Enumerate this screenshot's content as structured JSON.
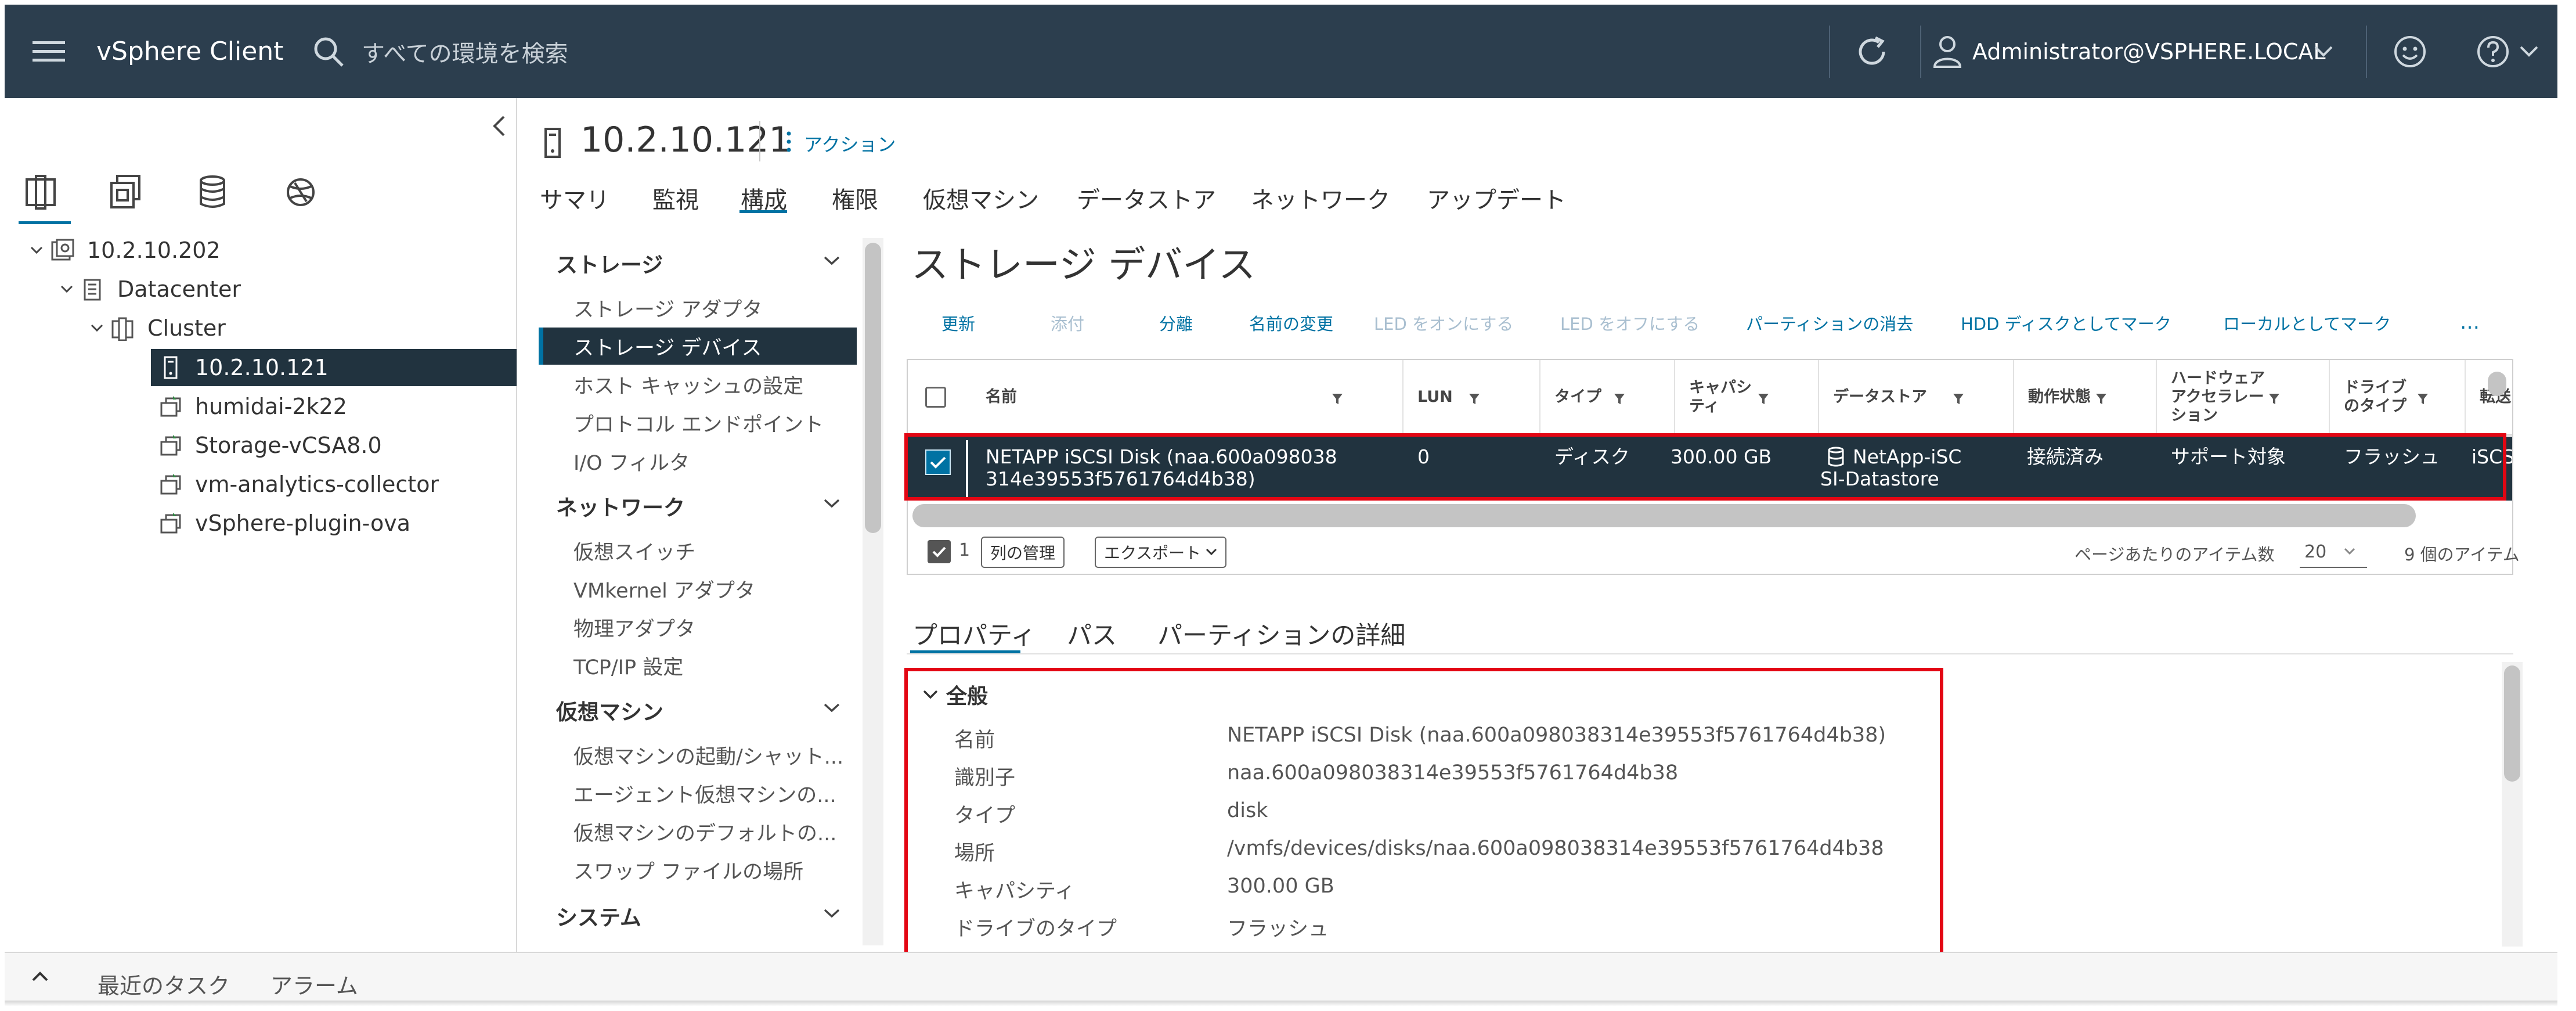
{
  "header": {
    "brand": "vSphere Client",
    "search_placeholder": "すべての環境を検索",
    "user": "Administrator@VSPHERE.LOCAL"
  },
  "icons": {
    "menu": "hamburger-icon",
    "search": "search-icon",
    "refresh": "refresh-icon",
    "user": "user-icon",
    "feedback": "smiley-icon",
    "help": "help-icon"
  },
  "colors": {
    "topbar": "#2c3e4e",
    "selection": "#21333f",
    "accent": "#0072a3",
    "highlight_box": "#e30613"
  },
  "tree": [
    {
      "label": "10.2.10.202",
      "icon": "vcenter-icon",
      "expanded": true
    },
    {
      "label": "Datacenter",
      "icon": "datacenter-icon",
      "expanded": true
    },
    {
      "label": "Cluster",
      "icon": "cluster-icon",
      "expanded": true
    },
    {
      "label": "10.2.10.121",
      "icon": "host-icon",
      "selected": true
    },
    {
      "label": "humidai-2k22",
      "icon": "vm-icon"
    },
    {
      "label": "Storage-vCSA8.0",
      "icon": "vm-icon"
    },
    {
      "label": "vm-analytics-collector",
      "icon": "vm-icon"
    },
    {
      "label": "vSphere-plugin-ova",
      "icon": "vm-icon"
    }
  ],
  "object": {
    "title": "10.2.10.121",
    "actions_label": "アクション"
  },
  "main_tabs": [
    "サマリ",
    "監視",
    "構成",
    "権限",
    "仮想マシン",
    "データストア",
    "ネットワーク",
    "アップデート"
  ],
  "config_nav": {
    "storage": {
      "title": "ストレージ",
      "items": [
        "ストレージ アダプタ",
        "ストレージ デバイス",
        "ホスト キャッシュの設定",
        "プロトコル エンドポイント",
        "I/O フィルタ"
      ]
    },
    "network": {
      "title": "ネットワーク",
      "items": [
        "仮想スイッチ",
        "VMkernel アダプタ",
        "物理アダプタ",
        "TCP/IP 設定"
      ]
    },
    "vm": {
      "title": "仮想マシン",
      "items": [
        "仮想マシンの起動/シャット...",
        "エージェント仮想マシンの...",
        "仮想マシンのデフォルトの...",
        "スワップ ファイルの場所"
      ]
    },
    "system": {
      "title": "システム"
    }
  },
  "content": {
    "title": "ストレージ デバイス",
    "toolbar": [
      "更新",
      "添付",
      "分離",
      "名前の変更",
      "LED をオンにする",
      "LED をオフにする",
      "パーティションの消去",
      "HDD ディスクとしてマーク",
      "ローカルとしてマーク"
    ],
    "toolbar_more": "…"
  },
  "grid": {
    "columns": [
      "名前",
      "LUN",
      "タイプ",
      "キャパシティ",
      "データストア",
      "動作状態",
      "ハードウェア アクセラレーション",
      "ドライブのタイプ",
      "転送"
    ],
    "column_lines": {
      "capacity": [
        "キャパシ",
        "ティ"
      ],
      "hw_accel": [
        "ハードウェア",
        "アクセラレー",
        "ション"
      ],
      "drive_type": [
        "ドライブ",
        "のタイプ"
      ]
    },
    "row": {
      "name_line1": "NETAPP iSCSI Disk (naa.600a098038",
      "name_line2": "314e39553f5761764d4b38)",
      "lun": "0",
      "type": "ディスク",
      "capacity": "300.00 GB",
      "datastore_line1": "NetApp-iSC",
      "datastore_line2": "SI-Datastore",
      "status": "接続済み",
      "hw_accel": "サポート対象",
      "drive_type": "フラッシュ",
      "transport": "iSCS"
    },
    "footer": {
      "selected_count": "1",
      "manage_columns": "列の管理",
      "export": "エクスポート",
      "per_page_label": "ページあたりのアイテム数",
      "per_page_value": "20",
      "item_count": "9 個のアイテム"
    }
  },
  "details_tabs": [
    "プロパティ",
    "パス",
    "パーティションの詳細"
  ],
  "properties": {
    "section": "全般",
    "rows": [
      {
        "label": "名前",
        "value": "NETAPP iSCSI Disk (naa.600a098038314e39553f5761764d4b38)"
      },
      {
        "label": "識別子",
        "value": "naa.600a098038314e39553f5761764d4b38"
      },
      {
        "label": "タイプ",
        "value": "disk"
      },
      {
        "label": "場所",
        "value": "/vmfs/devices/disks/naa.600a098038314e39553f5761764d4b38"
      },
      {
        "label": "キャパシティ",
        "value": "300.00 GB"
      },
      {
        "label": "ドライブのタイプ",
        "value": "フラッシュ"
      }
    ]
  },
  "bottom": {
    "tasks": "最近のタスク",
    "alarms": "アラーム"
  }
}
